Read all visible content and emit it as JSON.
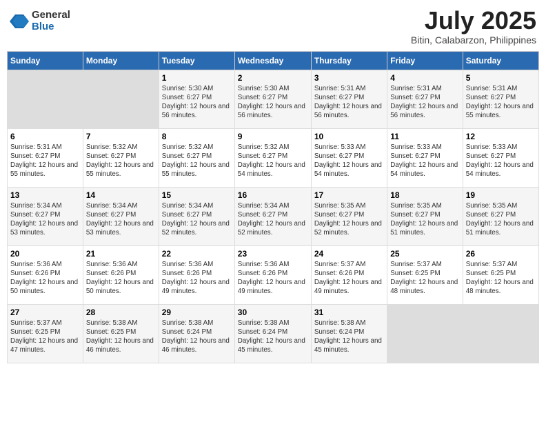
{
  "logo": {
    "general": "General",
    "blue": "Blue"
  },
  "title": {
    "month_year": "July 2025",
    "location": "Bitin, Calabarzon, Philippines"
  },
  "days_of_week": [
    "Sunday",
    "Monday",
    "Tuesday",
    "Wednesday",
    "Thursday",
    "Friday",
    "Saturday"
  ],
  "weeks": [
    [
      {
        "num": "",
        "info": ""
      },
      {
        "num": "",
        "info": ""
      },
      {
        "num": "1",
        "info": "Sunrise: 5:30 AM\nSunset: 6:27 PM\nDaylight: 12 hours\nand 56 minutes."
      },
      {
        "num": "2",
        "info": "Sunrise: 5:30 AM\nSunset: 6:27 PM\nDaylight: 12 hours\nand 56 minutes."
      },
      {
        "num": "3",
        "info": "Sunrise: 5:31 AM\nSunset: 6:27 PM\nDaylight: 12 hours\nand 56 minutes."
      },
      {
        "num": "4",
        "info": "Sunrise: 5:31 AM\nSunset: 6:27 PM\nDaylight: 12 hours\nand 56 minutes."
      },
      {
        "num": "5",
        "info": "Sunrise: 5:31 AM\nSunset: 6:27 PM\nDaylight: 12 hours\nand 55 minutes."
      }
    ],
    [
      {
        "num": "6",
        "info": "Sunrise: 5:31 AM\nSunset: 6:27 PM\nDaylight: 12 hours\nand 55 minutes."
      },
      {
        "num": "7",
        "info": "Sunrise: 5:32 AM\nSunset: 6:27 PM\nDaylight: 12 hours\nand 55 minutes."
      },
      {
        "num": "8",
        "info": "Sunrise: 5:32 AM\nSunset: 6:27 PM\nDaylight: 12 hours\nand 55 minutes."
      },
      {
        "num": "9",
        "info": "Sunrise: 5:32 AM\nSunset: 6:27 PM\nDaylight: 12 hours\nand 54 minutes."
      },
      {
        "num": "10",
        "info": "Sunrise: 5:33 AM\nSunset: 6:27 PM\nDaylight: 12 hours\nand 54 minutes."
      },
      {
        "num": "11",
        "info": "Sunrise: 5:33 AM\nSunset: 6:27 PM\nDaylight: 12 hours\nand 54 minutes."
      },
      {
        "num": "12",
        "info": "Sunrise: 5:33 AM\nSunset: 6:27 PM\nDaylight: 12 hours\nand 54 minutes."
      }
    ],
    [
      {
        "num": "13",
        "info": "Sunrise: 5:34 AM\nSunset: 6:27 PM\nDaylight: 12 hours\nand 53 minutes."
      },
      {
        "num": "14",
        "info": "Sunrise: 5:34 AM\nSunset: 6:27 PM\nDaylight: 12 hours\nand 53 minutes."
      },
      {
        "num": "15",
        "info": "Sunrise: 5:34 AM\nSunset: 6:27 PM\nDaylight: 12 hours\nand 52 minutes."
      },
      {
        "num": "16",
        "info": "Sunrise: 5:34 AM\nSunset: 6:27 PM\nDaylight: 12 hours\nand 52 minutes."
      },
      {
        "num": "17",
        "info": "Sunrise: 5:35 AM\nSunset: 6:27 PM\nDaylight: 12 hours\nand 52 minutes."
      },
      {
        "num": "18",
        "info": "Sunrise: 5:35 AM\nSunset: 6:27 PM\nDaylight: 12 hours\nand 51 minutes."
      },
      {
        "num": "19",
        "info": "Sunrise: 5:35 AM\nSunset: 6:27 PM\nDaylight: 12 hours\nand 51 minutes."
      }
    ],
    [
      {
        "num": "20",
        "info": "Sunrise: 5:36 AM\nSunset: 6:26 PM\nDaylight: 12 hours\nand 50 minutes."
      },
      {
        "num": "21",
        "info": "Sunrise: 5:36 AM\nSunset: 6:26 PM\nDaylight: 12 hours\nand 50 minutes."
      },
      {
        "num": "22",
        "info": "Sunrise: 5:36 AM\nSunset: 6:26 PM\nDaylight: 12 hours\nand 49 minutes."
      },
      {
        "num": "23",
        "info": "Sunrise: 5:36 AM\nSunset: 6:26 PM\nDaylight: 12 hours\nand 49 minutes."
      },
      {
        "num": "24",
        "info": "Sunrise: 5:37 AM\nSunset: 6:26 PM\nDaylight: 12 hours\nand 49 minutes."
      },
      {
        "num": "25",
        "info": "Sunrise: 5:37 AM\nSunset: 6:25 PM\nDaylight: 12 hours\nand 48 minutes."
      },
      {
        "num": "26",
        "info": "Sunrise: 5:37 AM\nSunset: 6:25 PM\nDaylight: 12 hours\nand 48 minutes."
      }
    ],
    [
      {
        "num": "27",
        "info": "Sunrise: 5:37 AM\nSunset: 6:25 PM\nDaylight: 12 hours\nand 47 minutes."
      },
      {
        "num": "28",
        "info": "Sunrise: 5:38 AM\nSunset: 6:25 PM\nDaylight: 12 hours\nand 46 minutes."
      },
      {
        "num": "29",
        "info": "Sunrise: 5:38 AM\nSunset: 6:24 PM\nDaylight: 12 hours\nand 46 minutes."
      },
      {
        "num": "30",
        "info": "Sunrise: 5:38 AM\nSunset: 6:24 PM\nDaylight: 12 hours\nand 45 minutes."
      },
      {
        "num": "31",
        "info": "Sunrise: 5:38 AM\nSunset: 6:24 PM\nDaylight: 12 hours\nand 45 minutes."
      },
      {
        "num": "",
        "info": ""
      },
      {
        "num": "",
        "info": ""
      }
    ]
  ]
}
